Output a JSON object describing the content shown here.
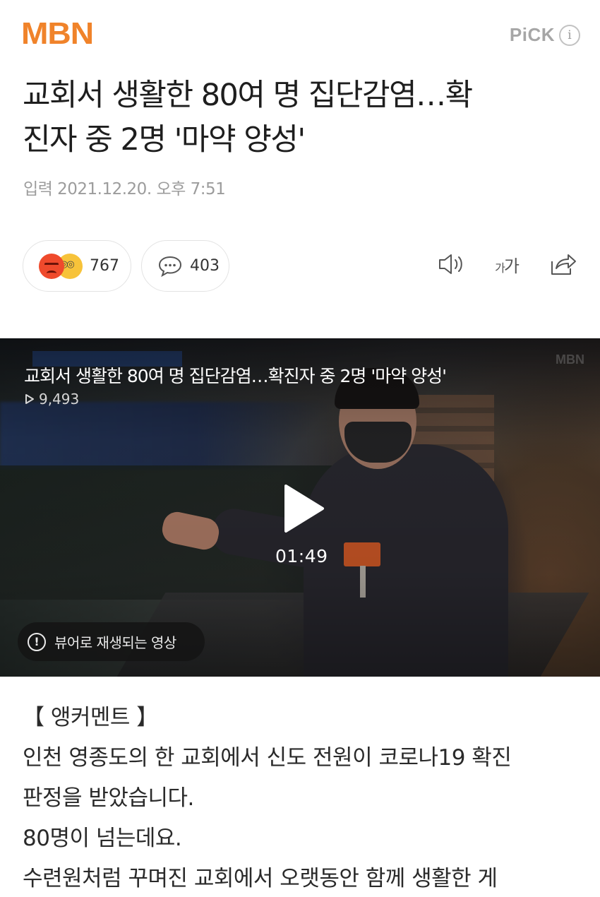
{
  "header": {
    "logo": "MBN",
    "pick_label": "PiCK",
    "pick_info_icon": "i"
  },
  "article": {
    "title_line1": "교회서 생활한 80여 명 집단감염…확",
    "title_line2": "진자 중 2명 '마약 양성'",
    "date": "입력 2021.12.20. 오후 7:51",
    "reactions": {
      "count": "767",
      "icons": [
        "angry-emoji-icon",
        "nerd-emoji-icon"
      ]
    },
    "comments": {
      "count": "403"
    },
    "tools": {
      "speaker_icon": "speaker-icon",
      "font_small": "가",
      "font_large": "가",
      "share_icon": "share-icon"
    }
  },
  "video": {
    "title": "교회서 생활한 80여 명 집단감염…확진자 중 2명 '마약 양성'",
    "views": "9,493",
    "duration": "01:49",
    "notice": "뷰어로 재생되는 영상",
    "notice_icon": "!"
  },
  "body": {
    "lines": [
      "【 앵커멘트 】",
      "인천 영종도의 한 교회에서 신도 전원이 코로나19 확진",
      "판정을 받았습니다.",
      "80명이 넘는데요.",
      "수련원처럼 꾸며진 교회에서 오랫동안 함께 생활한 게"
    ]
  },
  "colors": {
    "brand": "#f0832a",
    "text": "#222222",
    "muted": "#9c9c9c"
  }
}
